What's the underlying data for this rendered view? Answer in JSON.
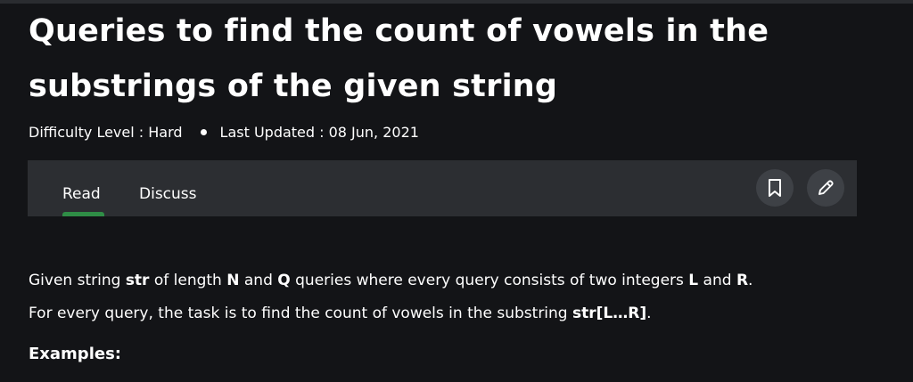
{
  "article": {
    "title": "Queries to find the count of vowels in the substrings of the given string",
    "difficulty_text": "Difficulty Level : Hard",
    "updated_text": "Last Updated : 08 Jun, 2021"
  },
  "toolbar": {
    "tabs": [
      {
        "label": "Read",
        "active": true
      },
      {
        "label": "Discuss",
        "active": false
      }
    ],
    "bookmark_icon": "bookmark-icon",
    "edit_icon": "pencil-icon",
    "active_tab_color": "#2f8d46"
  },
  "content": {
    "p1_a": "Given string ",
    "p1_str": "str",
    "p1_b": " of length ",
    "p1_n": "N",
    "p1_c": " and ",
    "p1_q": "Q",
    "p1_d": " queries where every query consists of two integers ",
    "p1_l": "L",
    "p1_e": " and ",
    "p1_r": "R",
    "p1_f": ".",
    "p2_a": "For every query, the task is to find the count of vowels in the substring ",
    "p2_sub": "str[L…R]",
    "p2_b": ".",
    "examples_heading": "Examples:"
  }
}
